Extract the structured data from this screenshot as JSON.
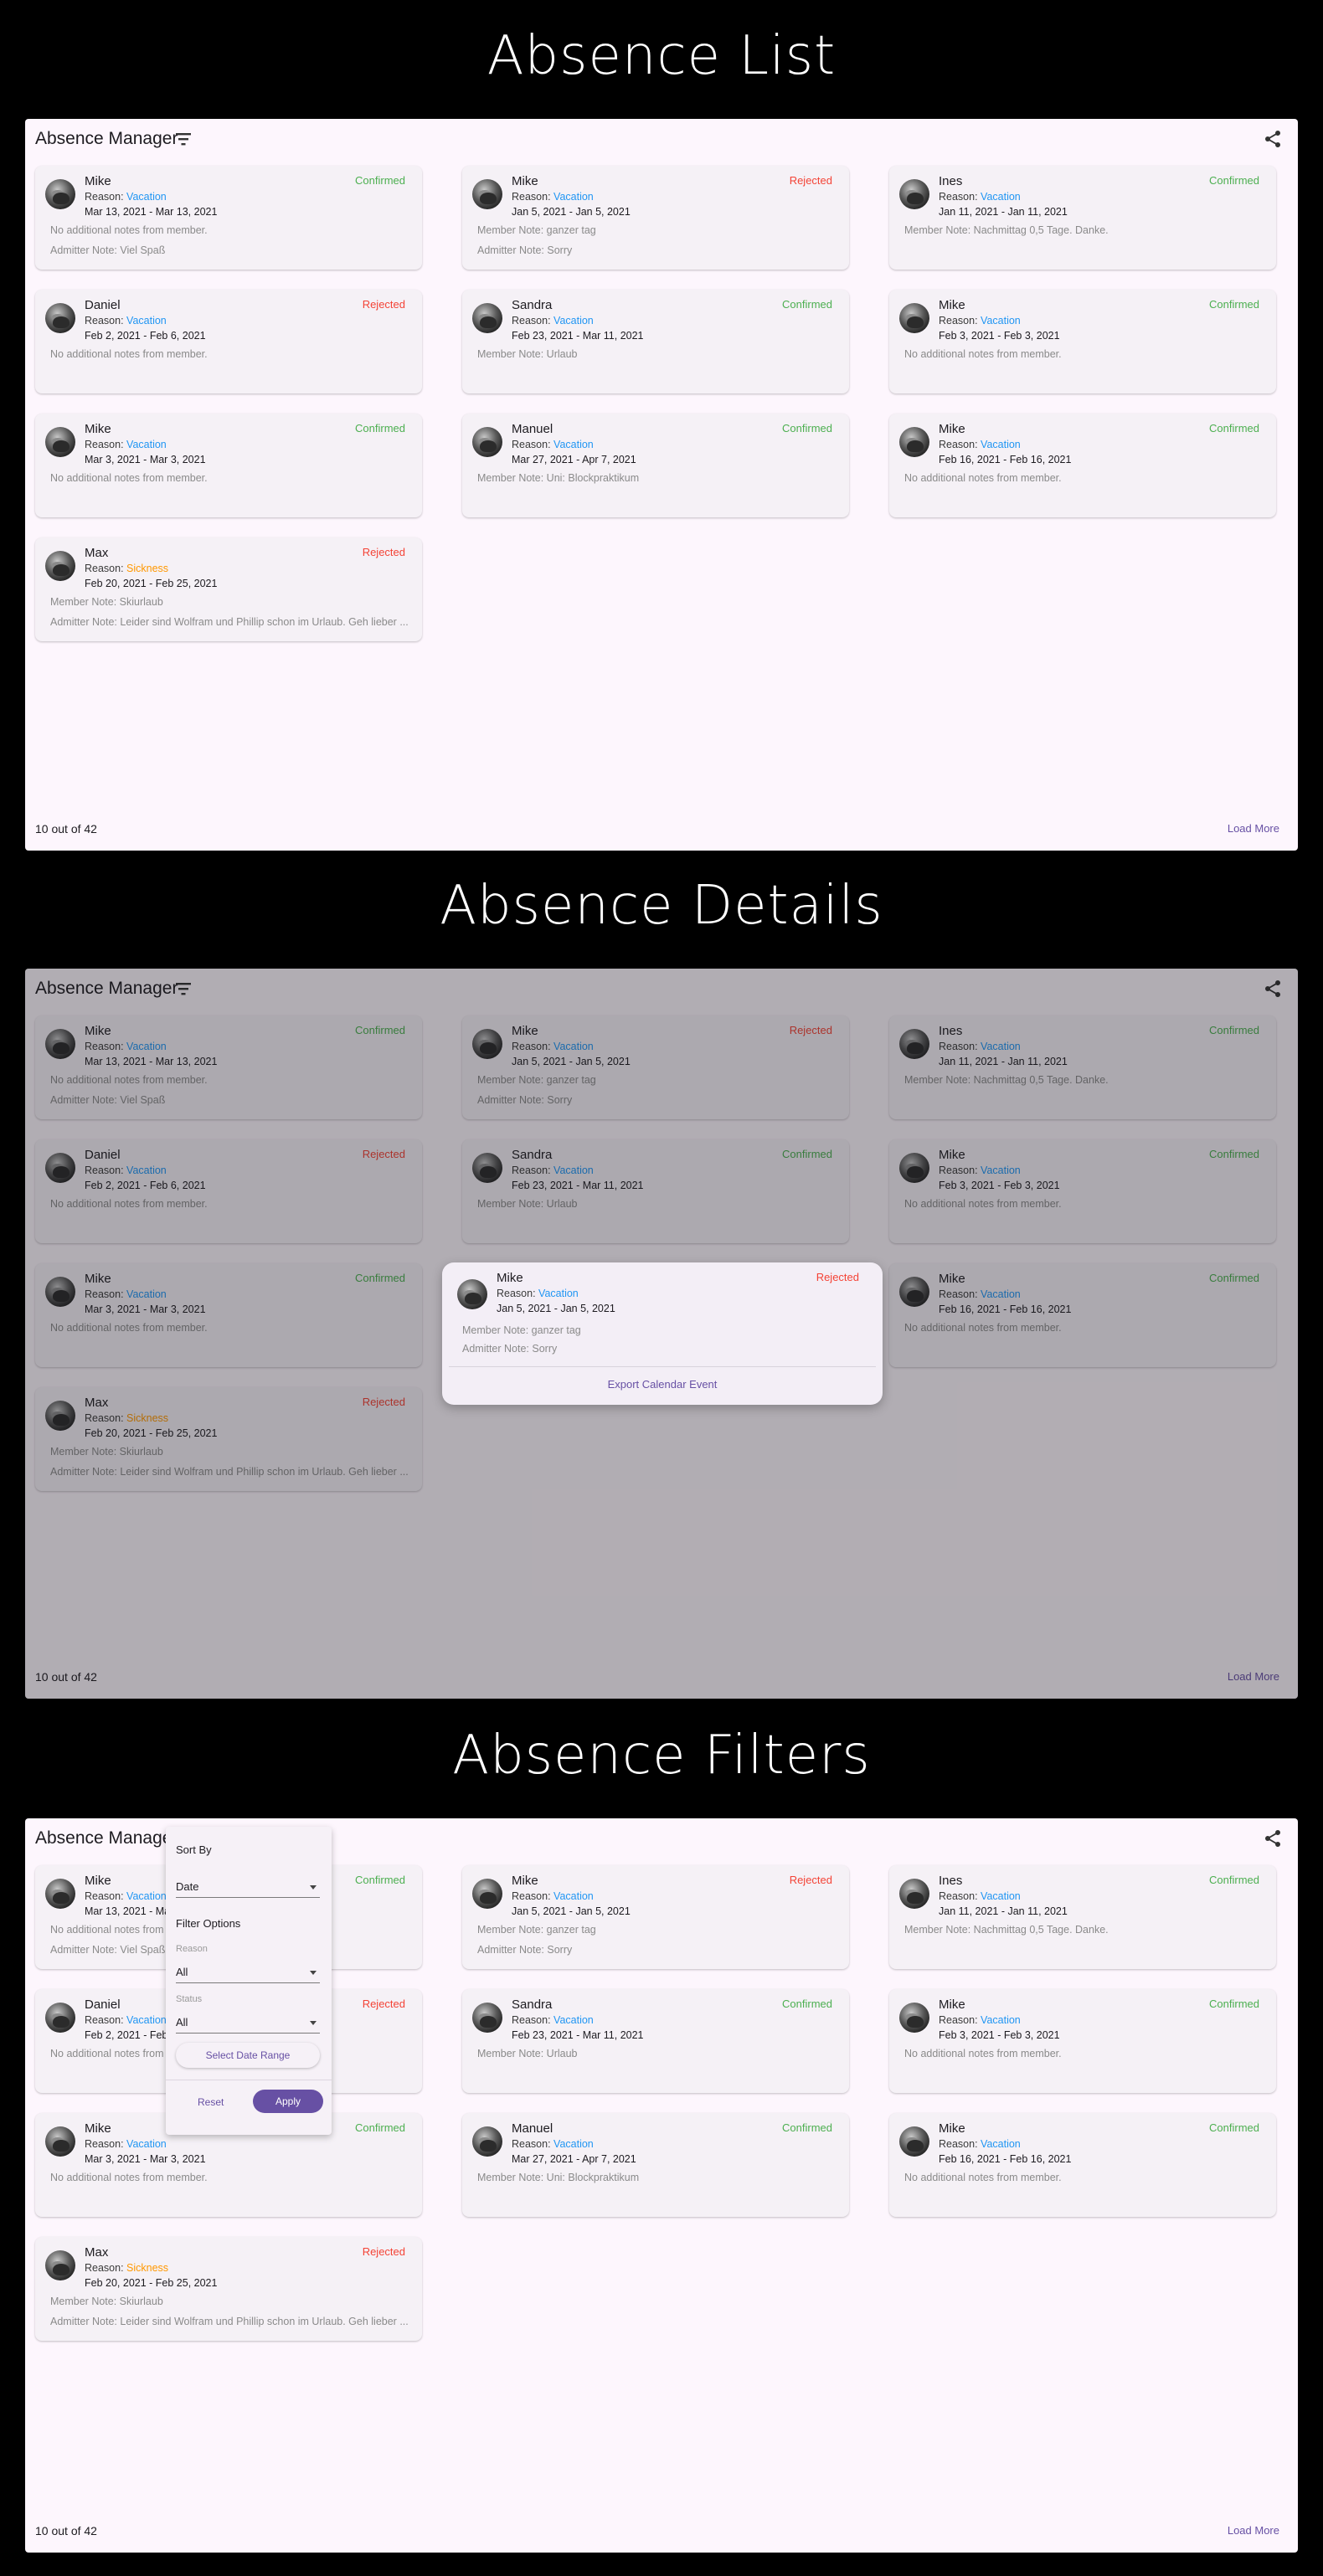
{
  "sections": [
    {
      "title": "Absence List"
    },
    {
      "title": "Absence Details"
    },
    {
      "title": "Absence Filters"
    }
  ],
  "app": {
    "title": "Absence Manager",
    "filter_icon": "filter-list-icon",
    "share_icon": "share-icon"
  },
  "labels": {
    "reason_prefix": "Reason: "
  },
  "cards": [
    {
      "name": "Mike",
      "reason": "Vacation",
      "dates": "Mar 13, 2021 - Mar 13, 2021",
      "status": "Confirmed",
      "note1": "No additional notes from member.",
      "note2": "Admitter Note: Viel Spaß"
    },
    {
      "name": "Mike",
      "reason": "Vacation",
      "dates": "Jan 5, 2021 - Jan 5, 2021",
      "status": "Rejected",
      "note1": "Member Note: ganzer tag",
      "note2": "Admitter Note: Sorry"
    },
    {
      "name": "Ines",
      "reason": "Vacation",
      "dates": "Jan 11, 2021 - Jan 11, 2021",
      "status": "Confirmed",
      "note1": "Member Note: Nachmittag 0,5 Tage. Danke.",
      "note2": ""
    },
    {
      "name": "Daniel",
      "reason": "Vacation",
      "dates": "Feb 2, 2021 - Feb 6, 2021",
      "status": "Rejected",
      "note1": "No additional notes from member.",
      "note2": ""
    },
    {
      "name": "Sandra",
      "reason": "Vacation",
      "dates": "Feb 23, 2021 - Mar 11, 2021",
      "status": "Confirmed",
      "note1": "Member Note: Urlaub",
      "note2": ""
    },
    {
      "name": "Mike",
      "reason": "Vacation",
      "dates": "Feb 3, 2021 - Feb 3, 2021",
      "status": "Confirmed",
      "note1": "No additional notes from member.",
      "note2": ""
    },
    {
      "name": "Mike",
      "reason": "Vacation",
      "dates": "Mar 3, 2021 - Mar 3, 2021",
      "status": "Confirmed",
      "note1": "No additional notes from member.",
      "note2": ""
    },
    {
      "name": "Manuel",
      "reason": "Vacation",
      "dates": "Mar 27, 2021 - Apr 7, 2021",
      "status": "Confirmed",
      "note1": "Member Note: Uni: Blockpraktikum",
      "note2": ""
    },
    {
      "name": "Mike",
      "reason": "Vacation",
      "dates": "Feb 16, 2021 - Feb 16, 2021",
      "status": "Confirmed",
      "note1": "No additional notes from member.",
      "note2": ""
    },
    {
      "name": "Max",
      "reason": "Sickness",
      "dates": "Feb 20, 2021 - Feb 25, 2021",
      "status": "Rejected",
      "note1": "Member Note: Skiurlaub",
      "note2": "Admitter Note: Leider sind Wolfram und Phillip schon im Urlaub. Geh lieber ..."
    }
  ],
  "footer": {
    "count": "10 out of 42",
    "load_more": "Load More"
  },
  "details_dialog": {
    "name": "Mike",
    "reason": "Vacation",
    "dates": "Jan 5, 2021 - Jan 5, 2021",
    "status": "Rejected",
    "note1": "Member Note: ganzer tag",
    "note2": "Admitter Note: Sorry",
    "action": "Export Calendar Event"
  },
  "filter_menu": {
    "sort_by_label": "Sort By",
    "sort_value": "Date",
    "filter_options_label": "Filter Options",
    "reason_label": "Reason",
    "reason_value": "All",
    "status_label": "Status",
    "status_value": "All",
    "date_range_button": "Select Date Range",
    "reset_button": "Reset",
    "apply_button": "Apply"
  },
  "colors": {
    "confirmed": "#4caf50",
    "rejected": "#f44336",
    "vacation": "#2196f3",
    "sickness": "#ff9800",
    "accent": "#6750a4"
  }
}
